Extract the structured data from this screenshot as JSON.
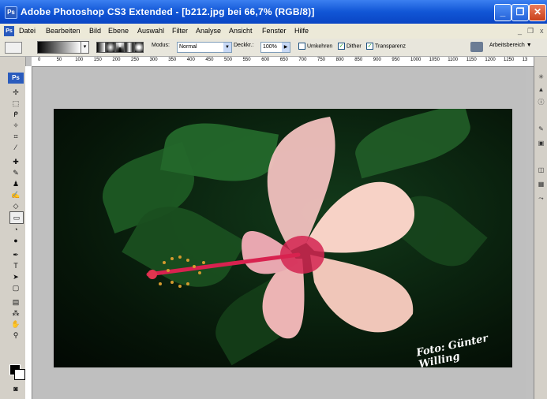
{
  "window": {
    "title": "Adobe Photoshop CS3 Extended - [b212.jpg bei 66,7% (RGB/8)]",
    "minimize": "_",
    "maximize": "❐",
    "close": "✕"
  },
  "menu": {
    "items": [
      "Datei",
      "Bearbeiten",
      "Bild",
      "Ebene",
      "Auswahl",
      "Filter",
      "Analyse",
      "Ansicht",
      "Fenster",
      "Hilfe"
    ],
    "doc_minimize": "_",
    "doc_restore": "❐",
    "doc_close": "x"
  },
  "options": {
    "modus_label": "Modus:",
    "modus_value": "Normal",
    "deckkr_label": "Deckkr.:",
    "deckkr_value": "100%",
    "umkehren": "Umkehren",
    "dither": "Dither",
    "transparenz": "Transparenz",
    "workspace": "Arbeitsbereich ▼"
  },
  "ruler": {
    "ticks": [
      "0",
      "50",
      "100",
      "150",
      "200",
      "250",
      "300",
      "350",
      "400",
      "450",
      "500",
      "550",
      "600",
      "650",
      "700",
      "750",
      "800",
      "850",
      "900",
      "950",
      "1000",
      "1050",
      "1100",
      "1150",
      "1200",
      "1250",
      "13"
    ]
  },
  "image": {
    "watermark": "Foto: Günter Willing"
  },
  "toolbox": {
    "logo": "Ps"
  },
  "colors": {
    "titlebar": "#1156d6",
    "chrome": "#ece9d8",
    "canvas_bg": "#bfbfbf"
  }
}
